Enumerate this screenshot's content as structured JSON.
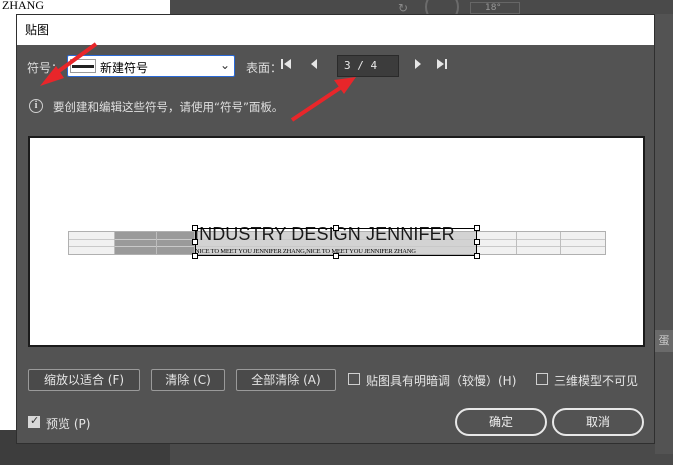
{
  "background": {
    "doc_text": "ZHANG",
    "field_value": "18°",
    "side_label": "蛋"
  },
  "dialog": {
    "title": "贴图",
    "symbol": {
      "label": "符号：",
      "selected": "新建符号"
    },
    "surface": {
      "label": "表面：",
      "first_icon": "first-page-icon",
      "prev_icon": "prev-page-icon",
      "page": "3 / 4",
      "next_icon": "next-page-icon",
      "last_icon": "last-page-icon"
    },
    "info_text": "要创建和编辑这些符号，请使用“符号”面板。",
    "preview": {
      "title": "INDUSTRY DESIGN JENNIFER",
      "subtitle": "NICE TO MEET YOU JENNIFER ZHANG,NICE TO MEET YOU JENNIFER ZHANG"
    },
    "buttons": {
      "fit": "缩放以适合 (F)",
      "clear": "清除 (C)",
      "clear_all": "全部清除 (A)"
    },
    "options": {
      "shade": {
        "label": "贴图具有明暗调（较慢）(H)",
        "checked": false
      },
      "invisible": {
        "label": "三维模型不可见",
        "checked": false
      },
      "preview": {
        "label": "预览 (P)",
        "checked": true
      }
    },
    "ok": "确定",
    "cancel": "取消"
  },
  "colors": {
    "dialog_bg": "#535353",
    "annotation_arrow": "#e8262a"
  }
}
